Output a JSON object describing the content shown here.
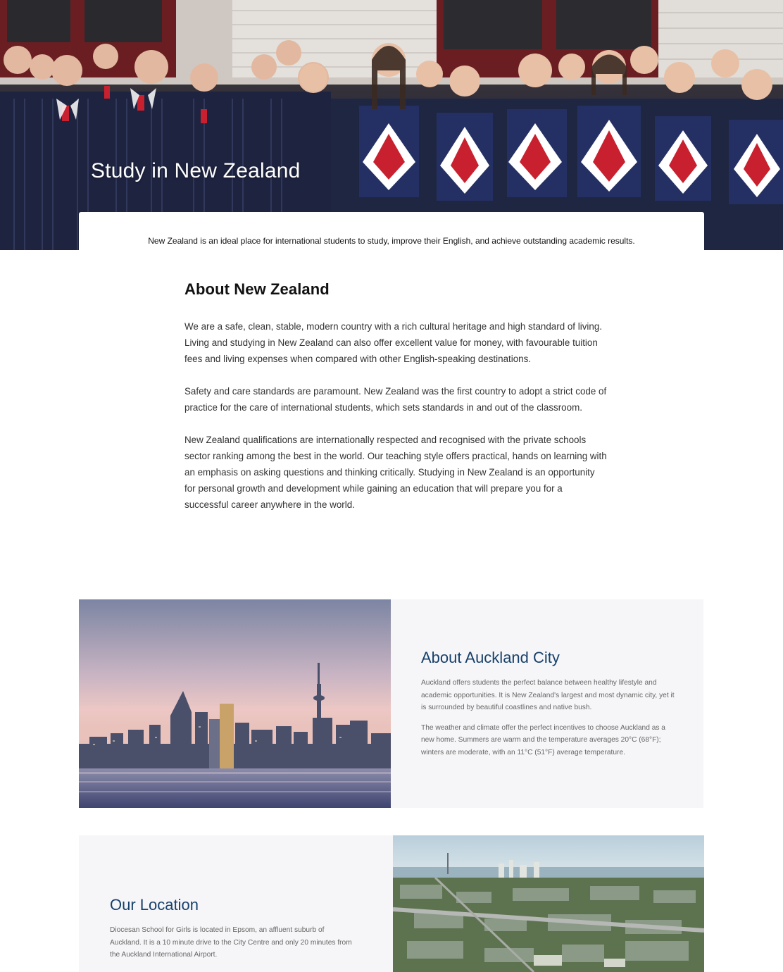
{
  "hero": {
    "title": "Study in New Zealand",
    "intro": "New Zealand is an ideal place for international students to study, improve their English, and achieve outstanding academic results."
  },
  "about_nz": {
    "heading": "About New Zealand",
    "paragraphs": [
      "We are a safe, clean, stable, modern country with a rich cultural heritage and high standard of living. Living and studying in New Zealand can also offer excellent value for money, with favourable tuition fees and living expenses when compared with other English-speaking destinations.",
      "Safety and care standards are paramount. New Zealand was the first country to adopt a strict code of practice for the care of international students, which sets standards in and out of the classroom.",
      "New Zealand qualifications are internationally respected and recognised with the private schools sector ranking among the best in the world. Our teaching style offers practical, hands on learning with an emphasis on asking questions and thinking critically. Studying in New Zealand is an opportunity for personal growth and development while gaining an education that will prepare you for a successful career anywhere in the world."
    ]
  },
  "auckland": {
    "heading": "About Auckland City",
    "paragraphs": [
      "Auckland offers students the perfect balance between healthy lifestyle and academic opportunities. It is New Zealand's largest and most dynamic city, yet it is surrounded by beautiful coastlines and native bush.",
      "The weather and climate offer the perfect incentives to choose Auckland as a new home. Summers are warm and the temperature averages 20°C (68°F); winters are moderate, with an 11°C (51°F) average temperature."
    ]
  },
  "location": {
    "heading": "Our Location",
    "paragraphs": [
      "Diocesan School for Girls is located in Epsom, an affluent suburb of Auckland. It is a 10 minute drive to the City Centre and only 20 minutes from the Auckland International Airport."
    ]
  },
  "colors": {
    "heading_blue": "#17406b",
    "panel_bg": "#f6f6f8",
    "uniform_navy": "#1f2642",
    "accent_red": "#c8202e"
  }
}
